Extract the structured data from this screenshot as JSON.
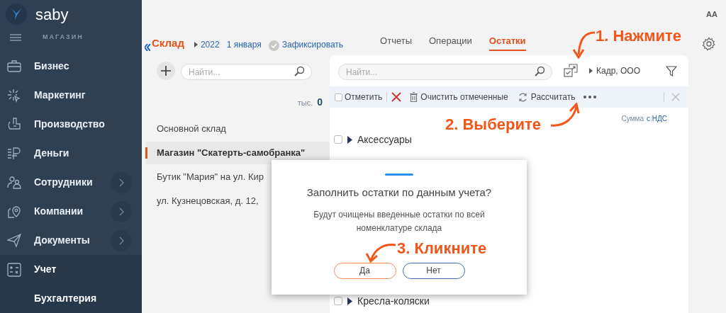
{
  "app": {
    "logo": "saby",
    "section": "МАГАЗИН",
    "font_toggle": "AA"
  },
  "sidebar": {
    "items": [
      {
        "label": "Бизнес",
        "kind": "briefcase",
        "has_submenu": false,
        "selected": false
      },
      {
        "label": "Маркетинг",
        "kind": "sparkle",
        "has_submenu": false,
        "selected": false
      },
      {
        "label": "Производство",
        "kind": "factory",
        "has_submenu": false,
        "selected": false
      },
      {
        "label": "Деньги",
        "kind": "ruble",
        "has_submenu": false,
        "selected": false
      },
      {
        "label": "Сотрудники",
        "kind": "people",
        "has_submenu": true,
        "selected": false
      },
      {
        "label": "Компании",
        "kind": "pin",
        "has_submenu": true,
        "selected": false
      },
      {
        "label": "Документы",
        "kind": "plane",
        "has_submenu": true,
        "selected": false
      },
      {
        "label": "Учет",
        "kind": "calculator",
        "has_submenu": false,
        "selected": true
      },
      {
        "label": "Бухгалтерия",
        "kind": "sub",
        "has_submenu": false,
        "selected": true
      }
    ]
  },
  "header": {
    "title": "Склад",
    "year": "2022",
    "date": "1 января",
    "fix_action": "Зафиксировать",
    "tabs": [
      {
        "label": "Отчеты",
        "selected": false
      },
      {
        "label": "Операции",
        "selected": false
      },
      {
        "label": "Остатки",
        "selected": true
      }
    ]
  },
  "warehouses": {
    "search_placeholder": "Найти...",
    "total_unit": "тыс.",
    "total": "0",
    "items": [
      {
        "label": "Основной склад",
        "selected": false
      },
      {
        "label": "Магазин \"Скатерть-самобранка\"",
        "selected": true
      },
      {
        "label": "Бутик \"Мария\" на ул. Кир",
        "selected": false
      },
      {
        "label": "ул. Кузнецовская, д. 12,",
        "selected": false
      }
    ]
  },
  "remains": {
    "search_placeholder": "Найти...",
    "organization": "Кадр, ООО",
    "mark_all_checked": false,
    "mark_label": "Отметить",
    "clear_label": "Очистить отмеченные",
    "calc_label": "Рассчитать",
    "sum_label": "Сумма",
    "sum_mode": "с НДС",
    "rows": [
      {
        "label": "Аксессуары",
        "checked": false
      },
      {
        "label": "Кресла-коляски",
        "checked": false
      }
    ]
  },
  "dialog": {
    "title": "Заполнить остатки по данным учета?",
    "message": "Будут очищены введенные остатки по всей номенклатуре склада",
    "buttons": [
      {
        "label": "Да",
        "kind": "primary"
      },
      {
        "label": "Нет",
        "kind": "secondary"
      }
    ]
  },
  "annotations": [
    "1. Нажмите",
    "2. Выберите",
    "3. Кликните"
  ]
}
